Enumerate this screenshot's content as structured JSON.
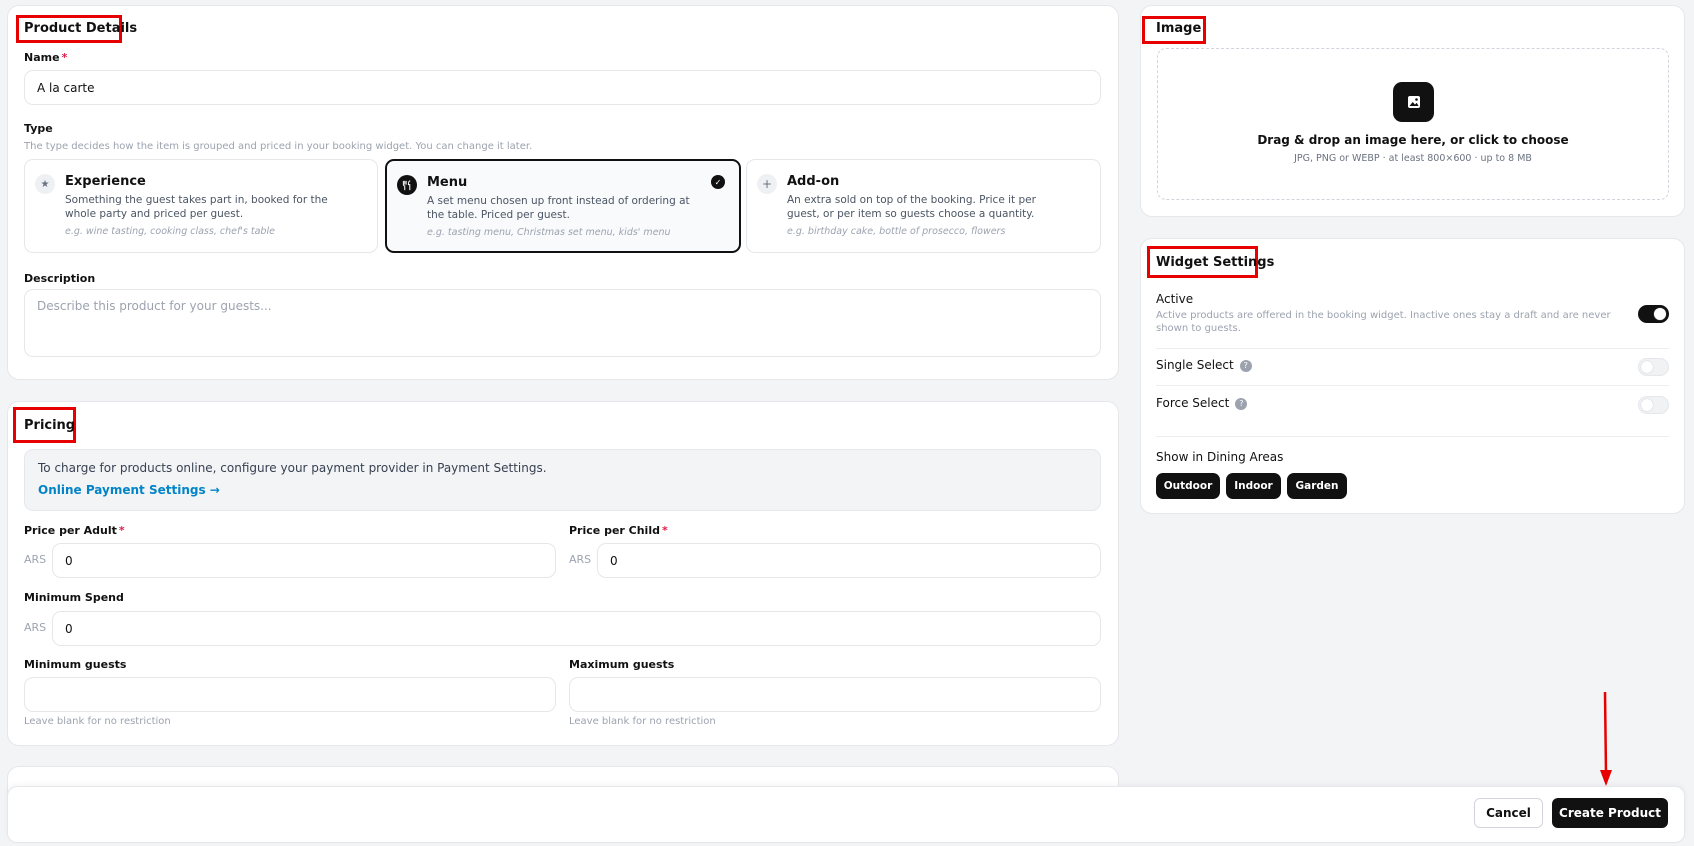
{
  "product_details": {
    "title": "Product Details",
    "name_label": "Name",
    "required_mark": "*",
    "name_value": "A la carte",
    "type_label": "Type",
    "type_help": "The type decides how the item is grouped and priced in your booking widget. You can change it later.",
    "types": [
      {
        "title": "Experience",
        "desc": "Something the guest takes part in, booked for the whole party and priced per guest.",
        "example": "e.g. wine tasting, cooking class, chef's table",
        "icon": "star-icon",
        "selected": false
      },
      {
        "title": "Menu",
        "desc": "A set menu chosen up front instead of ordering at the table. Priced per guest.",
        "example": "e.g. tasting menu, Christmas set menu, kids' menu",
        "icon": "cutlery-icon",
        "selected": true
      },
      {
        "title": "Add-on",
        "desc": "An extra sold on top of the booking. Price it per guest, or per item so guests choose a quantity.",
        "example": "e.g. birthday cake, bottle of prosecco, flowers",
        "icon": "plus-icon",
        "selected": false
      }
    ],
    "description_label": "Description",
    "description_placeholder": "Describe this product for your guests..."
  },
  "pricing": {
    "title": "Pricing",
    "notice_text": "To charge for products online, configure your payment provider in Payment Settings.",
    "notice_link": "Online Payment Settings →",
    "adult_label": "Price per Adult",
    "child_label": "Price per Child",
    "min_spend_label": "Minimum Spend",
    "currency": "ARS",
    "adult_value": "0",
    "child_value": "0",
    "min_spend_value": "0",
    "min_guests_label": "Minimum guests",
    "max_guests_label": "Maximum guests",
    "min_guests_value": "",
    "max_guests_value": "",
    "guests_help": "Leave blank for no restriction"
  },
  "image": {
    "title": "Image",
    "drop_text": "Drag & drop an image here, or click to choose",
    "drop_help": "JPG, PNG or WEBP · at least 800×600 · up to 8 MB"
  },
  "widget": {
    "title": "Widget Settings",
    "active_label": "Active",
    "active_desc": "Active products are offered in the booking widget. Inactive ones stay a draft and are never shown to guests.",
    "active_on": true,
    "single_select_label": "Single Select",
    "single_select_on": false,
    "force_select_label": "Force Select",
    "force_select_on": false,
    "info_glyph": "?",
    "dining_label": "Show in Dining Areas",
    "dining_areas": [
      "Outdoor",
      "Indoor",
      "Garden"
    ]
  },
  "footer": {
    "cancel_label": "Cancel",
    "create_label": "Create Product"
  },
  "colors": {
    "annotation": "#e60000",
    "link": "#0284c7",
    "primary": "#111111"
  }
}
